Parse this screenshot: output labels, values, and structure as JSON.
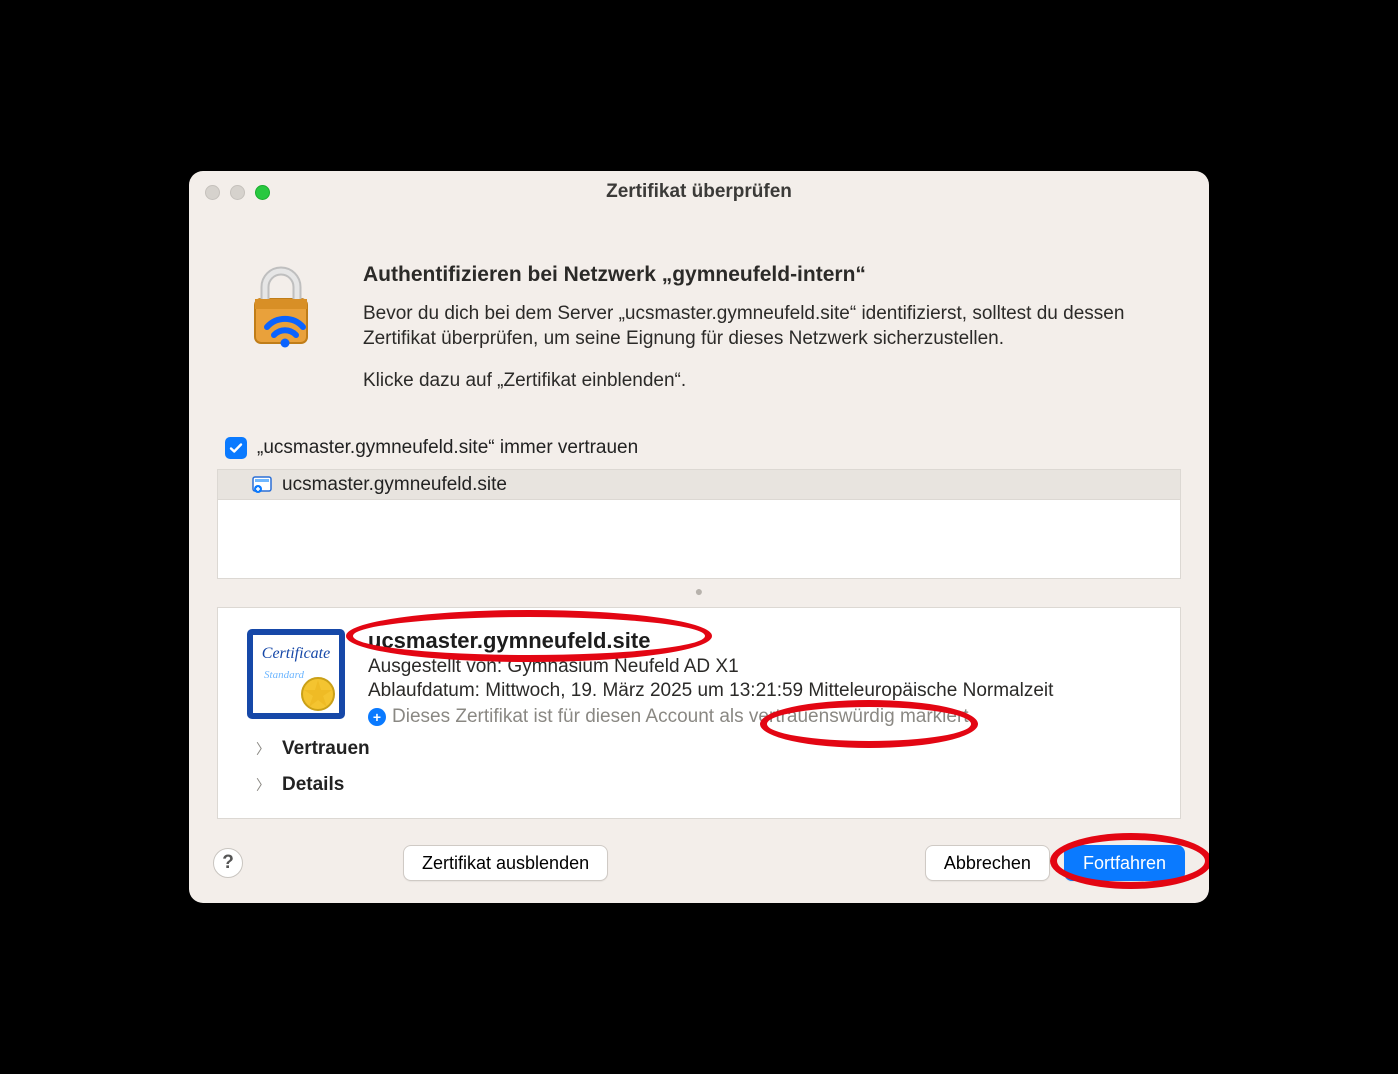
{
  "window": {
    "title": "Zertifikat überprüfen",
    "heading": "Authentifizieren bei Netzwerk „gymneufeld-intern“",
    "paragraph": "Bevor du dich bei dem Server „ucsmaster.gymneufeld.site“ identifizierst, solltest du dessen Zertifikat überprüfen, um seine Eignung für dieses Netzwerk sicherzustellen.",
    "hint": "Klicke dazu auf „Zertifikat einblenden“."
  },
  "trust": {
    "checkbox_checked": true,
    "label": "„ucsmaster.gymneufeld.site“ immer vertrauen"
  },
  "cert_list": {
    "items": [
      {
        "name": "ucsmaster.gymneufeld.site"
      }
    ]
  },
  "cert_detail": {
    "name": "ucsmaster.gymneufeld.site",
    "issued_by": "Ausgestellt von: Gymnasium Neufeld AD X1",
    "expires": "Ablaufdatum: Mittwoch, 19. März 2025 um 13:21:59 Mitteleuropäische Normalzeit",
    "trust_status": "Dieses Zertifikat ist für diesen Account als vertrauenswürdig markiert.",
    "sections": {
      "trust": "Vertrauen",
      "details": "Details"
    }
  },
  "footer": {
    "hide_cert": "Zertifikat ausblenden",
    "cancel": "Abbrechen",
    "continue": "Fortfahren",
    "help_tooltip": "?"
  },
  "annotations": {
    "cert_name": "highlight",
    "trust_word": "highlight",
    "continue_button": "highlight"
  }
}
